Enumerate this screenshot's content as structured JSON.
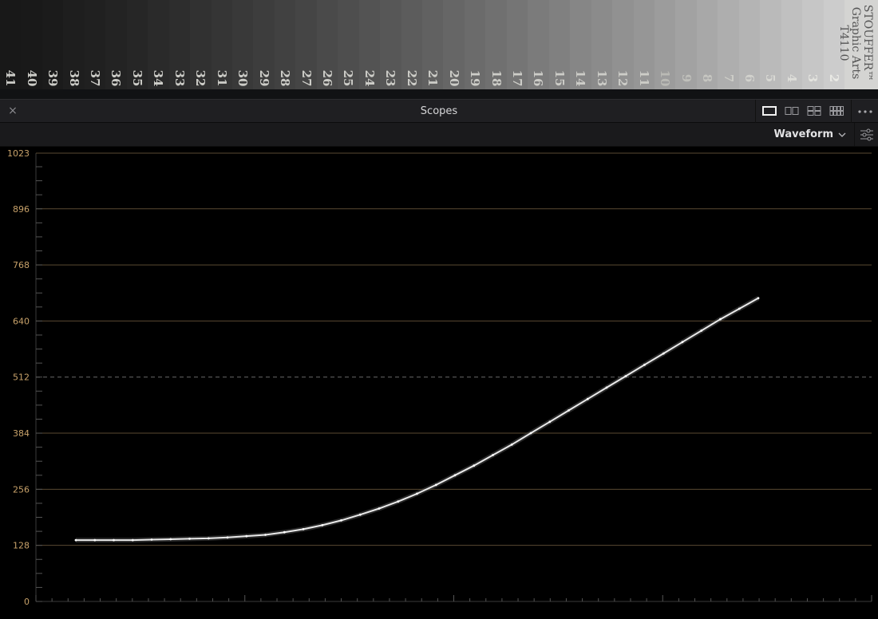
{
  "wedge": {
    "step_numbers": [
      "41",
      "40",
      "39",
      "38",
      "37",
      "36",
      "35",
      "34",
      "33",
      "32",
      "31",
      "30",
      "29",
      "28",
      "27",
      "26",
      "25",
      "24",
      "23",
      "22",
      "21",
      "20",
      "19",
      "18",
      "17",
      "16",
      "15",
      "14",
      "13",
      "12",
      "11",
      "10",
      "9",
      "8",
      "7",
      "6",
      "5",
      "4",
      "3",
      "2"
    ],
    "brand": {
      "line1": "STOUFFER™",
      "line2": "Graphic Arts",
      "line3": "T4110"
    }
  },
  "panel": {
    "title": "Scopes",
    "close_glyph": "×",
    "layout_icons": [
      "single-view-icon",
      "dual-view-icon",
      "quad-view-icon",
      "octa-view-icon"
    ],
    "more_icon": "more-options-icon"
  },
  "toolbar": {
    "scope_type": "Waveform",
    "dropdown_icon": "chevron-down-icon",
    "settings_icon": "settings-sliders-icon"
  },
  "colors": {
    "accent_label": "#c8a26a",
    "gridline": "#5a4a32",
    "trace": "#ffffff"
  },
  "chart_data": {
    "type": "line",
    "y_ticks": [
      "1023",
      "896",
      "768",
      "640",
      "512",
      "384",
      "256",
      "128",
      "0"
    ],
    "ylim": [
      0,
      1023
    ],
    "reference_line": 512,
    "xlim": [
      0,
      1
    ],
    "series": [
      {
        "x": [
          0.0,
          0.025,
          0.05,
          0.075,
          0.1,
          0.125,
          0.15,
          0.175,
          0.2,
          0.225,
          0.25,
          0.275,
          0.3,
          0.325,
          0.35,
          0.375,
          0.4,
          0.425,
          0.45,
          0.475,
          0.5,
          0.525,
          0.55,
          0.575,
          0.6,
          0.625,
          0.65,
          0.675,
          0.7,
          0.725,
          0.75,
          0.775,
          0.8,
          0.825,
          0.85,
          0.875,
          0.9
        ],
        "values": [
          140,
          140,
          140,
          140,
          141,
          142,
          143,
          144,
          146,
          149,
          152,
          158,
          165,
          174,
          185,
          198,
          212,
          228,
          246,
          266,
          288,
          310,
          334,
          358,
          384,
          410,
          436,
          462,
          488,
          514,
          540,
          566,
          592,
          618,
          644,
          668,
          692
        ]
      }
    ]
  }
}
